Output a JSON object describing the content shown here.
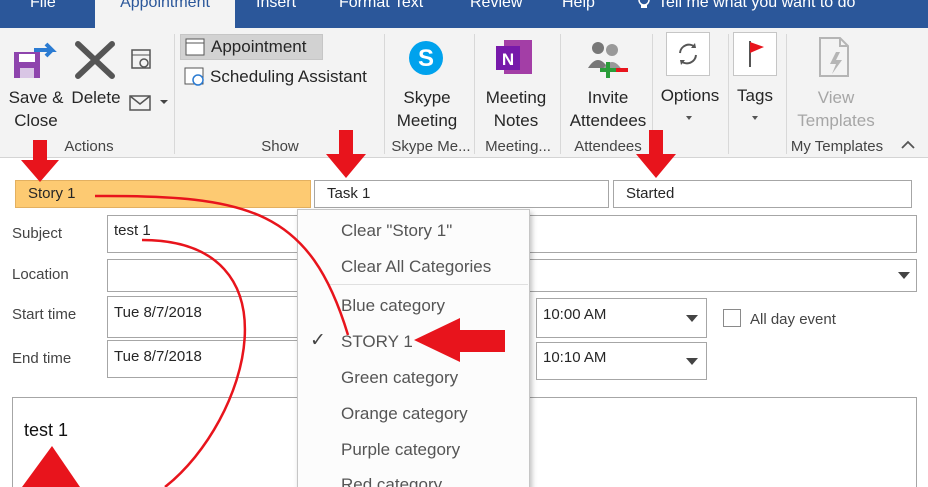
{
  "tabs": [
    "File",
    "Appointment",
    "Insert",
    "Format Text",
    "Review",
    "Help"
  ],
  "tell_me": "Tell me what you want to do",
  "ribbon": {
    "save_close": [
      "Save &",
      "Close"
    ],
    "delete": "Delete",
    "actions_label": "Actions",
    "appointment": "Appointment",
    "scheduling_assistant": "Scheduling Assistant",
    "show_label": "Show",
    "skype_meeting": [
      "Skype",
      "Meeting"
    ],
    "skype_label": "Skype Me...",
    "meeting_notes": [
      "Meeting",
      "Notes"
    ],
    "meeting_label": "Meeting...",
    "invite_attendees": [
      "Invite",
      "Attendees"
    ],
    "attendees_label": "Attendees",
    "options": "Options",
    "tags": "Tags",
    "view_templates": [
      "View",
      "Templates"
    ],
    "templates_label": "My Templates"
  },
  "categories": [
    "Story 1",
    "Task 1",
    "Started"
  ],
  "form": {
    "subject_label": "Subject",
    "subject_value": "test 1",
    "location_label": "Location",
    "location_value": "",
    "start_label": "Start time",
    "start_date": "Tue 8/7/2018",
    "start_time": "10:00 AM",
    "end_label": "End time",
    "end_date": "Tue 8/7/2018",
    "end_time": "10:10 AM",
    "all_day": "All day event"
  },
  "notes_text": "test 1",
  "menu": {
    "clear_one": "Clear \"Story 1\"",
    "clear_all": "Clear All Categories",
    "items": [
      "Blue category",
      "STORY 1",
      "Green category",
      "Orange category",
      "Purple category",
      "Red category"
    ],
    "checked": "STORY 1"
  },
  "colors": {
    "tab_bar": "#2b579a",
    "category_story": "#fdca72",
    "annotation": "#e8141c"
  }
}
